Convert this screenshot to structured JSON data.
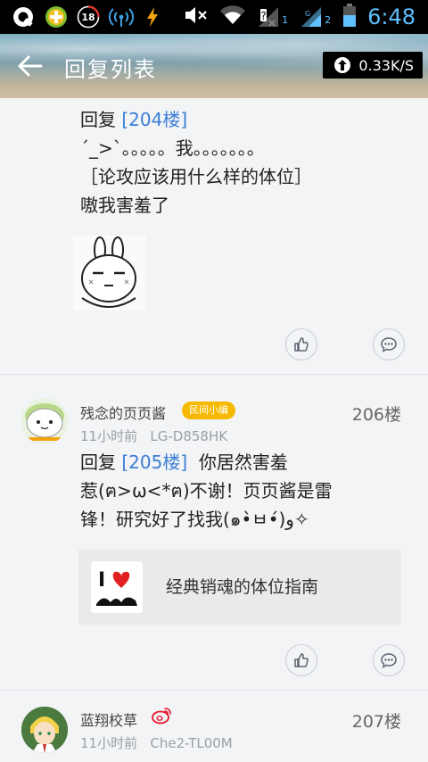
{
  "status_bar": {
    "left_icons": [
      "q-circle-icon",
      "gamepad-plus-icon",
      "notification-18-icon",
      "wifi-tether-icon",
      "flash-icon"
    ],
    "badge_18": "18",
    "sim1": "1",
    "sim2": "2",
    "clock": "6:48"
  },
  "header": {
    "title": "回复列表",
    "speed": "0.33K/S"
  },
  "posts": [
    {
      "text_line1_prefix": "回复 ",
      "text_line1_floor": "[204楼]",
      "text_line2": "´_>`。。。。。我。。。。。。。",
      "text_line3": "［论攻应该用什么样的体位］",
      "text_line4": "嗷我害羞了"
    },
    {
      "username": "残念的页页酱",
      "badge": "民间小编",
      "time": "11小时前",
      "device": "LG-D858HK",
      "floor": "206楼",
      "text_line1_prefix": "回复 ",
      "text_line1_floor": "[205楼]",
      "text_line1_rest": "你居然害羞",
      "text_line2": "惹(ฅ>ω<*ฅ)不谢！页页酱是雷",
      "text_line3": "锋！研究好了找我(๑•̀ㅂ•́)و✧",
      "link_title": "经典销魂的体位指南",
      "link_icon_label": "I"
    },
    {
      "username": "蓝翔校草",
      "time": "11小时前",
      "device": "Che2-TL00M",
      "floor": "207楼"
    }
  ],
  "colors": {
    "accent_link": "#3c7ed6",
    "clock": "#5ec0ff",
    "badge": "#f6b900",
    "weibo": "#e6162d"
  }
}
